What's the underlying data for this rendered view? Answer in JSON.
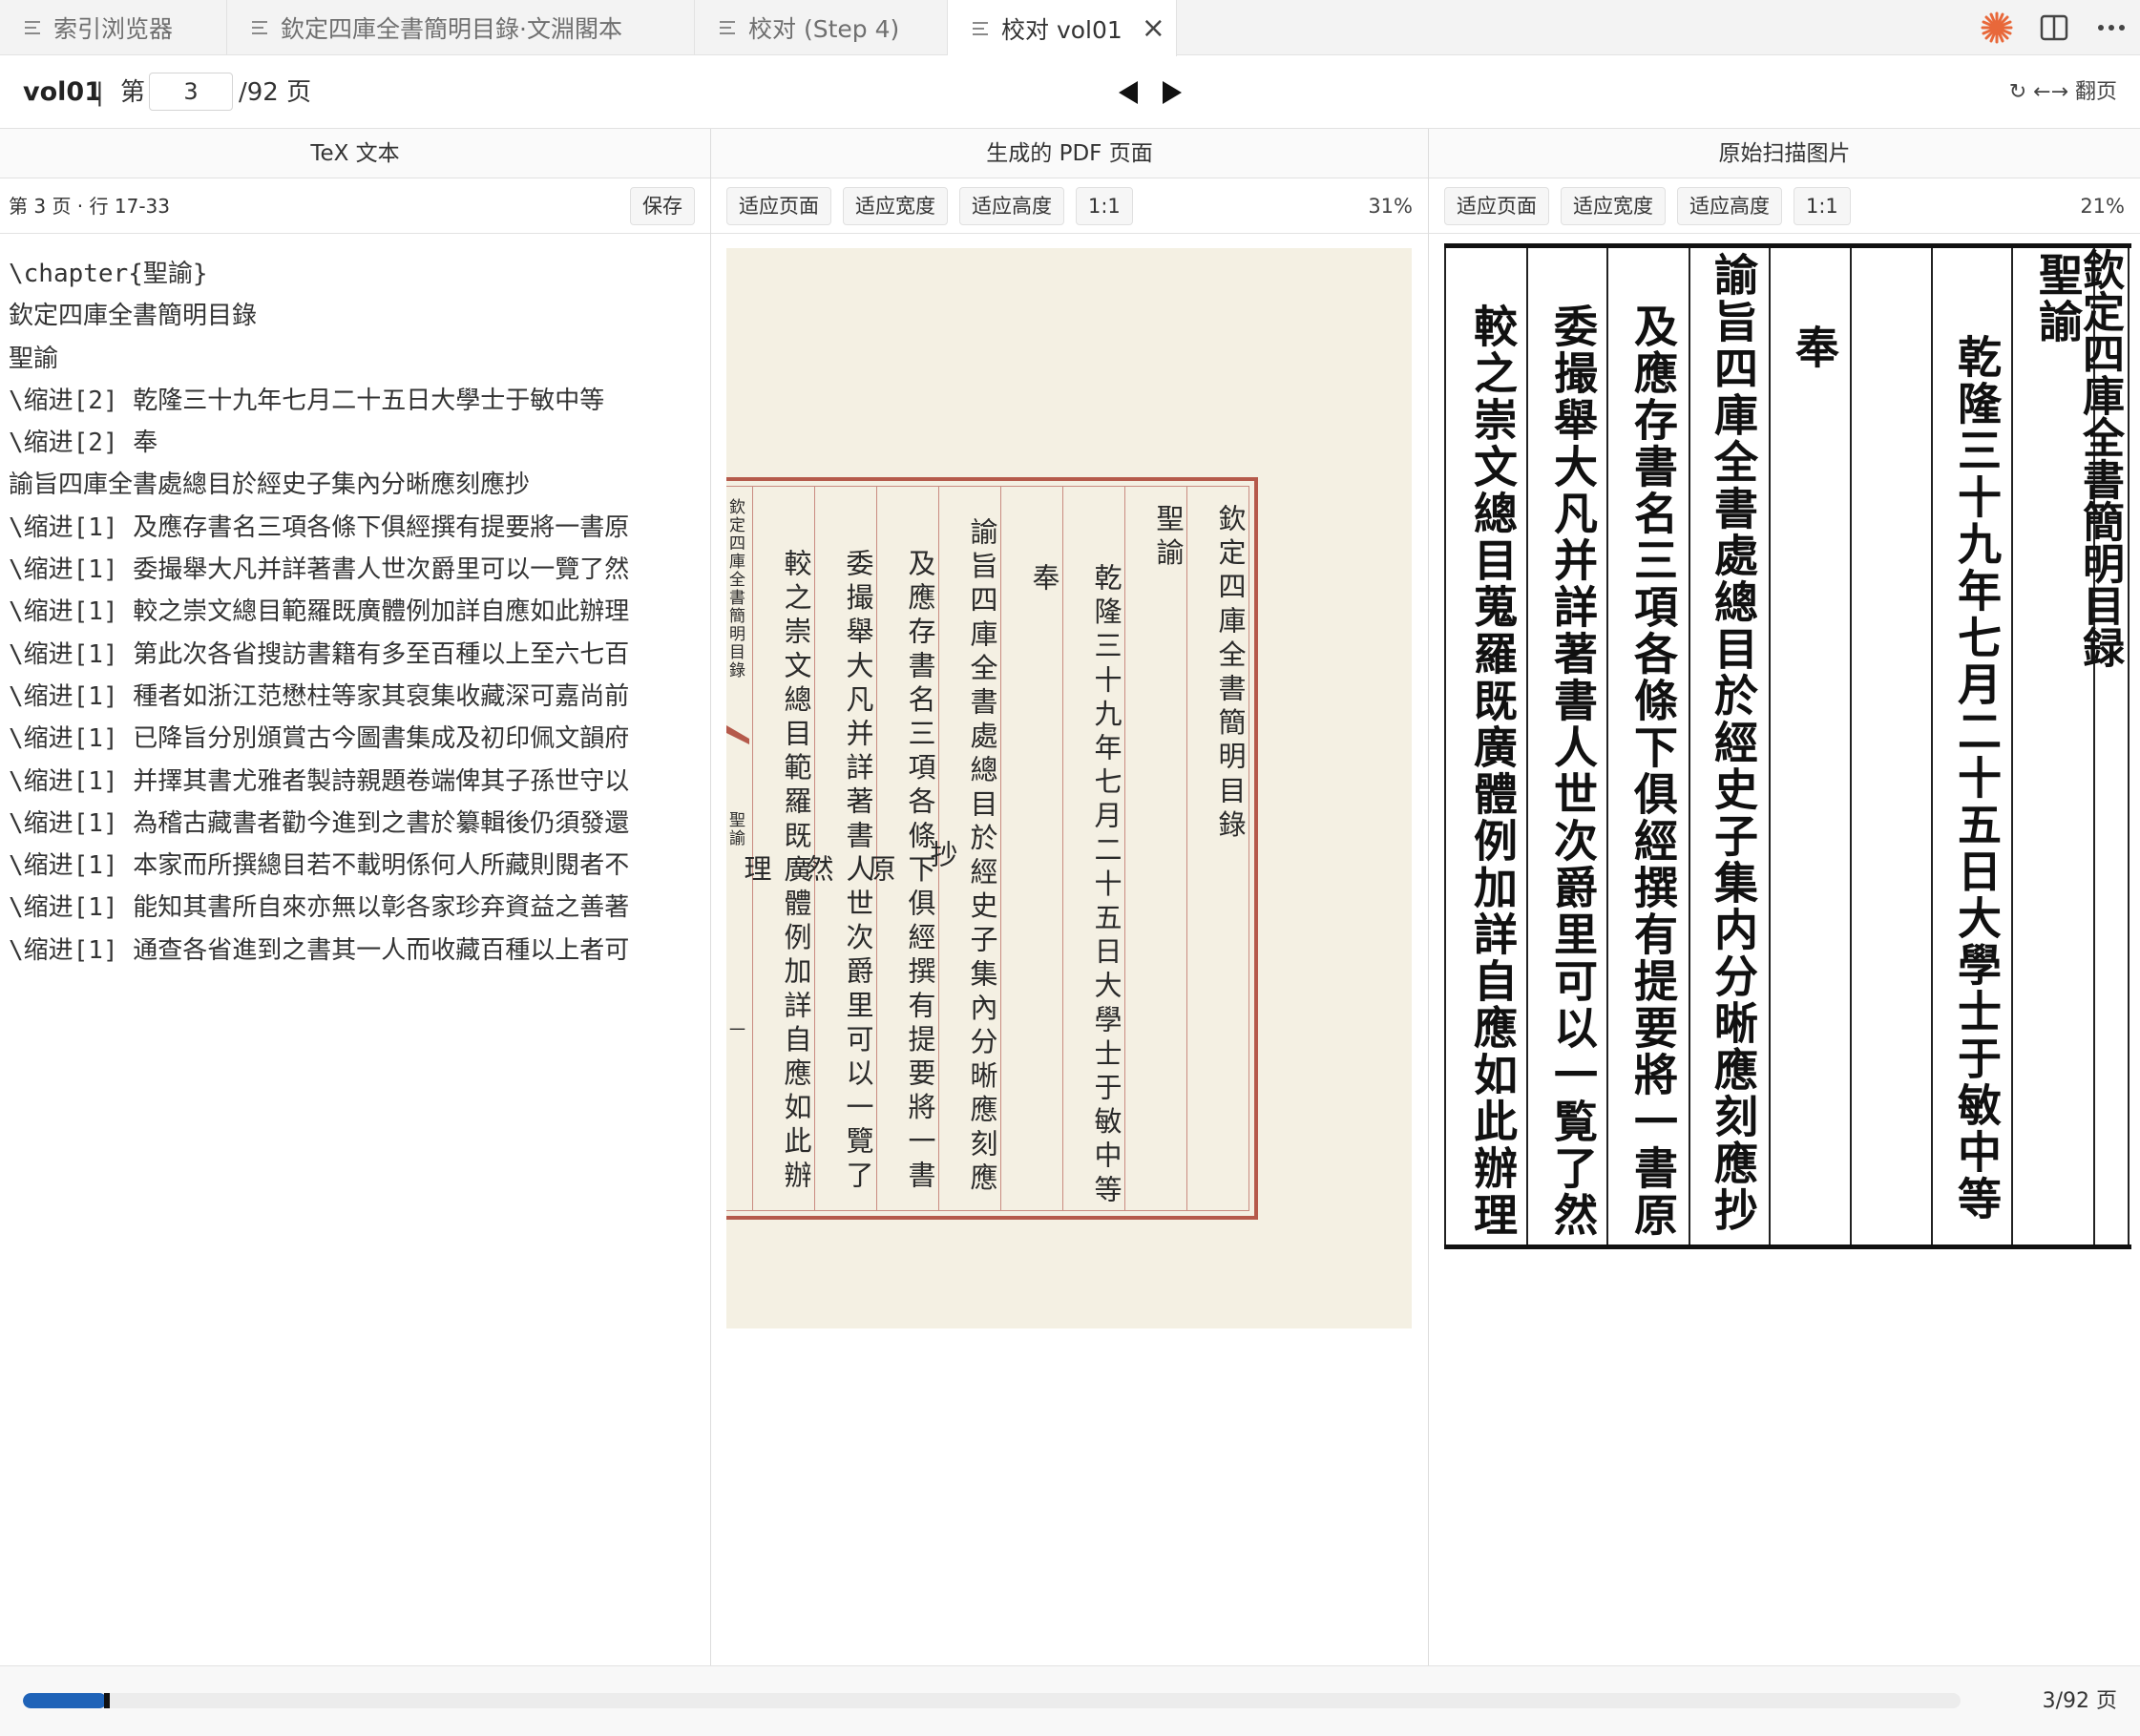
{
  "tabs": [
    {
      "label": "索引浏览器",
      "active": false
    },
    {
      "label": "欽定四庫全書簡明目錄·文淵閣本",
      "active": false
    },
    {
      "label": "校对 (Step 4)",
      "active": false
    },
    {
      "label": "校对 vol01",
      "active": true
    }
  ],
  "toolbar": {
    "volume": "vol01",
    "separator": "|",
    "page_prefix": "第",
    "page_value": "3",
    "page_suffix": "/92 页",
    "flip_hint": "↻ ←→ 翻页"
  },
  "tex_pane": {
    "title": "TeX 文本",
    "info": "第 3 页 · 行 17-33",
    "save_label": "保存",
    "lines": [
      "\\chapter{聖諭}",
      "欽定四庫全書簡明目錄",
      "聖諭",
      "\\缩进[2] 乾隆三十九年七月二十五日大學士于敏中等",
      "\\缩进[2] 奉",
      "諭旨四庫全書處總目於經史子集內分晰應刻應抄",
      "\\缩进[1] 及應存書名三項各條下俱經撰有提要將一書原",
      "\\缩进[1] 委撮舉大凡并詳著書人世次爵里可以一覽了然",
      "\\缩进[1] 較之崇文總目範羅既廣體例加詳自應如此辦理",
      "\\缩进[1] 第此次各省搜訪書籍有多至百種以上至六七百",
      "\\缩进[1] 種者如浙江范懋柱等家其裒集收藏深可嘉尚前",
      "\\缩进[1] 已降旨分別頒賞古今圖書集成及初印佩文韻府",
      "\\缩进[1] 并擇其書尤雅者製詩親題卷端俾其子孫世守以",
      "\\缩进[1] 為稽古藏書者勸今進到之書於纂輯後仍須發還",
      "\\缩进[1] 本家而所撰總目若不載明係何人所藏則閱者不",
      "\\缩进[1] 能知其書所自來亦無以彰各家珍弃資益之善著",
      "\\缩进[1] 通查各省進到之書其一人而收藏百種以上者可"
    ]
  },
  "pdf_pane": {
    "title": "生成的 PDF 页面",
    "buttons": [
      "适应页面",
      "适应宽度",
      "适应高度",
      "1:1"
    ],
    "zoom": "31%",
    "columns": [
      "欽定四庫全書簡明目錄",
      "聖諭",
      "乾隆三十九年七月二十五日大學士于敏中等",
      "奉",
      "諭旨四庫全書處總目於經史子集內分晰應刻應抄",
      "及應存書名三項各條下俱經撰有提要將一書原",
      "委撮舉大凡并詳著書人世次爵里可以一覽了然",
      "較之崇文總目範羅既廣體例加詳自應如此辦理"
    ],
    "margin_title": "欽定四庫全書簡明目錄",
    "margin_section": "聖諭",
    "margin_page": "一"
  },
  "scan_pane": {
    "title": "原始扫描图片",
    "buttons": [
      "适应页面",
      "适应宽度",
      "适应高度",
      "1:1"
    ],
    "zoom": "21%",
    "columns": [
      "欽定四庫全書簡明目録",
      "聖諭",
      "乾隆三十九年七月二十五日大學士于敏中等",
      "",
      "奉",
      "諭旨四庫全書處總目於經史子集内分晰應刻應抄",
      "及應存書名三項各條下俱經撰有提要將一書原",
      "委撮舉大凡并詳著書人世次爵里可以一覧了然",
      "較之崇文總目蒐羅既廣體例加詳自應如此辦理"
    ]
  },
  "status": {
    "count": "3/92 页",
    "progress": 0.0326
  },
  "colors": {
    "accent": "#1f63b8",
    "frame": "#b55a4b",
    "paper": "#f4f0e3",
    "logo": "#e8683a"
  }
}
